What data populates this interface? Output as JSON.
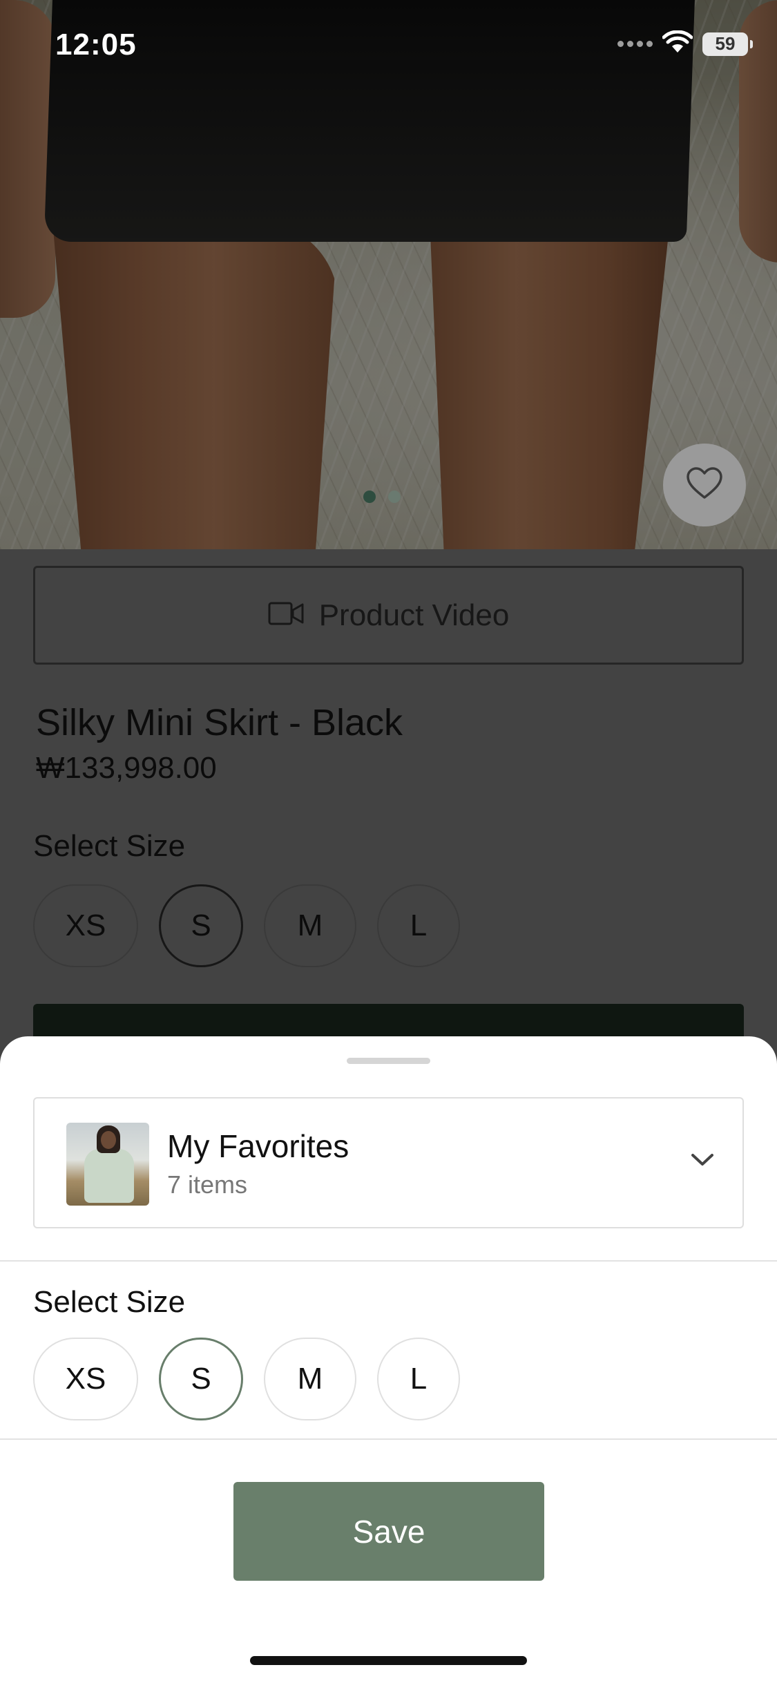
{
  "status_bar": {
    "time": "12:05",
    "battery": "59"
  },
  "hero": {
    "image_dots": 2,
    "active_dot": 0
  },
  "product": {
    "video_button_label": "Product Video",
    "title": "Silky Mini Skirt - Black",
    "price": "₩133,998.00",
    "size_label": "Select Size",
    "sizes": [
      "XS",
      "S",
      "M",
      "L"
    ],
    "selected_size": "S"
  },
  "sheet": {
    "collection": {
      "name": "My Favorites",
      "count": "7 items"
    },
    "size_label": "Select Size",
    "sizes": [
      "XS",
      "S",
      "M",
      "L"
    ],
    "selected_size": "S",
    "save_label": "Save"
  },
  "colors": {
    "accent": "#697f6b",
    "selected_border": "#687e6b",
    "dot_active": "#2e4d3f"
  },
  "icons": [
    "wifi-icon",
    "battery-icon",
    "heart-icon",
    "video-camera-icon",
    "chevron-down-icon"
  ]
}
